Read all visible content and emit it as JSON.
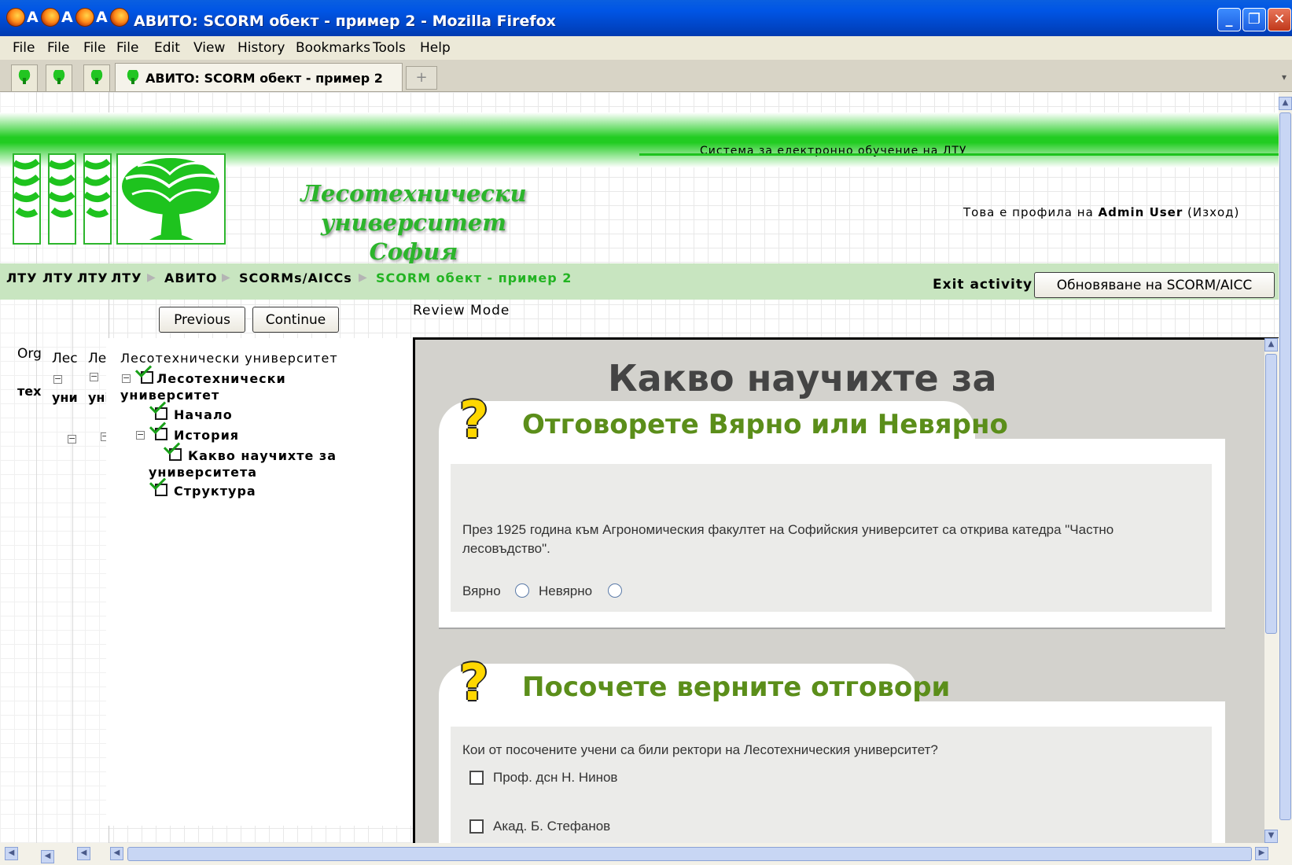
{
  "window": {
    "title": "АВИТО: SCORM обект - пример 2 - Mozilla Firefox",
    "stub_letter": "А"
  },
  "menu": {
    "file_stub": "File",
    "items": [
      "File",
      "Edit",
      "View",
      "History",
      "Bookmarks",
      "Tools",
      "Help"
    ]
  },
  "tabs": {
    "active_label": "АВИТО: SCORM обект - пример 2",
    "new_tab_glyph": "+"
  },
  "site": {
    "system_name": "Система за електронно обучение на ЛТУ",
    "university_line1": "Лесотехнически университет",
    "university_line2": "София",
    "profile_prefix": "Това е профила на",
    "profile_user": "Admin User",
    "logout_text": "(Изход)"
  },
  "breadcrumb": {
    "stub": "ЛТУ",
    "items": [
      "ЛТУ",
      "АВИТО",
      "SCORMs/AICCs",
      "SCORM обект - пример 2"
    ],
    "separator": "▶"
  },
  "activity": {
    "exit_label": "Exit activity",
    "update_button": "Обновяване на SCORM/AICC",
    "previous_button": "Previous",
    "continue_button": "Continue",
    "mode": "Review Mode"
  },
  "toc": {
    "stub_texts": [
      "Org",
      "тех",
      "Лес",
      "уни",
      "Ле",
      "уні"
    ],
    "root": "Лесотехнически университет",
    "items": [
      {
        "label_1": "Лесотехнически",
        "label_2": "университет"
      },
      {
        "label": "Начало"
      },
      {
        "label": "История"
      },
      {
        "label_1": "Какво научихте за",
        "label_2": "университета"
      },
      {
        "label": "Структура"
      }
    ]
  },
  "content": {
    "title": "Какво научихте за университета",
    "q1": {
      "heading": "Отговорете Вярно или Невярно",
      "text": "През 1925 година към Агрономическия факултет на Софийския университет са открива катедра \"Частно лесовъдство\".",
      "true_label": "Вярно",
      "false_label": "Невярно"
    },
    "q2": {
      "heading": "Посочете верните отговори",
      "text": "Кои от посочените учени са били ректори на Лесотехническия университет?",
      "options": [
        "Проф. дсн Н. Нинов",
        "Акад. Б. Стефанов"
      ]
    }
  },
  "colors": {
    "brand_green": "#2cb52c",
    "heading_green": "#5b8e1a",
    "breadcrumb_bg": "#c8e5c0",
    "titlebar_blue": "#0055e5"
  }
}
